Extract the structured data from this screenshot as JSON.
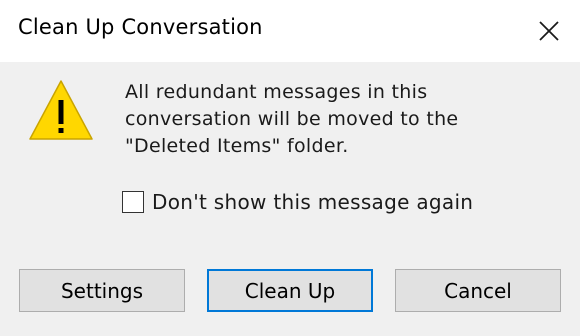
{
  "window": {
    "title": "Clean Up Conversation",
    "close_icon": "close-icon"
  },
  "message": {
    "icon": "warning-icon",
    "lines": [
      "All redundant messages in this",
      "conversation will be moved to the",
      "\"Deleted Items\" folder."
    ]
  },
  "checkbox": {
    "label": "Don't show this message again",
    "checked": false
  },
  "buttons": {
    "settings": "Settings",
    "clean_up": "Clean Up",
    "cancel": "Cancel"
  },
  "colors": {
    "warning_fill": "#ffd700",
    "focus_border": "#0078d7",
    "button_face": "#e1e1e1"
  }
}
